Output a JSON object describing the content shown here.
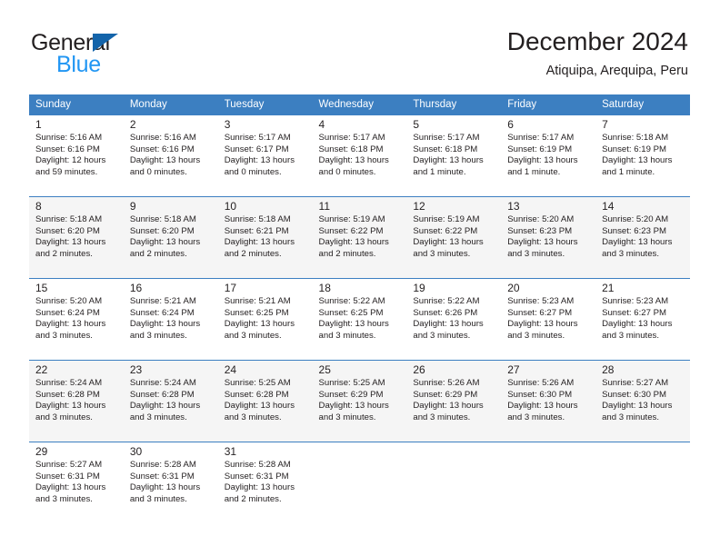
{
  "brand": {
    "word1": "General",
    "word2": "Blue",
    "flag_icon": "triangle-flag-icon",
    "accent_dark": "#1464aa",
    "accent_light": "#2196f3"
  },
  "header": {
    "title": "December 2024",
    "subtitle": "Atiquipa, Arequipa, Peru"
  },
  "calendar": {
    "header_bg": "#3c7fc1",
    "shaded_row_bg": "#f5f5f5",
    "weekday_headers": [
      "Sunday",
      "Monday",
      "Tuesday",
      "Wednesday",
      "Thursday",
      "Friday",
      "Saturday"
    ],
    "weeks": [
      {
        "shaded": false,
        "days": [
          {
            "num": "1",
            "detail": "Sunrise: 5:16 AM\nSunset: 6:16 PM\nDaylight: 12 hours\nand 59 minutes."
          },
          {
            "num": "2",
            "detail": "Sunrise: 5:16 AM\nSunset: 6:16 PM\nDaylight: 13 hours\nand 0 minutes."
          },
          {
            "num": "3",
            "detail": "Sunrise: 5:17 AM\nSunset: 6:17 PM\nDaylight: 13 hours\nand 0 minutes."
          },
          {
            "num": "4",
            "detail": "Sunrise: 5:17 AM\nSunset: 6:18 PM\nDaylight: 13 hours\nand 0 minutes."
          },
          {
            "num": "5",
            "detail": "Sunrise: 5:17 AM\nSunset: 6:18 PM\nDaylight: 13 hours\nand 1 minute."
          },
          {
            "num": "6",
            "detail": "Sunrise: 5:17 AM\nSunset: 6:19 PM\nDaylight: 13 hours\nand 1 minute."
          },
          {
            "num": "7",
            "detail": "Sunrise: 5:18 AM\nSunset: 6:19 PM\nDaylight: 13 hours\nand 1 minute."
          }
        ]
      },
      {
        "shaded": true,
        "days": [
          {
            "num": "8",
            "detail": "Sunrise: 5:18 AM\nSunset: 6:20 PM\nDaylight: 13 hours\nand 2 minutes."
          },
          {
            "num": "9",
            "detail": "Sunrise: 5:18 AM\nSunset: 6:20 PM\nDaylight: 13 hours\nand 2 minutes."
          },
          {
            "num": "10",
            "detail": "Sunrise: 5:18 AM\nSunset: 6:21 PM\nDaylight: 13 hours\nand 2 minutes."
          },
          {
            "num": "11",
            "detail": "Sunrise: 5:19 AM\nSunset: 6:22 PM\nDaylight: 13 hours\nand 2 minutes."
          },
          {
            "num": "12",
            "detail": "Sunrise: 5:19 AM\nSunset: 6:22 PM\nDaylight: 13 hours\nand 3 minutes."
          },
          {
            "num": "13",
            "detail": "Sunrise: 5:20 AM\nSunset: 6:23 PM\nDaylight: 13 hours\nand 3 minutes."
          },
          {
            "num": "14",
            "detail": "Sunrise: 5:20 AM\nSunset: 6:23 PM\nDaylight: 13 hours\nand 3 minutes."
          }
        ]
      },
      {
        "shaded": false,
        "days": [
          {
            "num": "15",
            "detail": "Sunrise: 5:20 AM\nSunset: 6:24 PM\nDaylight: 13 hours\nand 3 minutes."
          },
          {
            "num": "16",
            "detail": "Sunrise: 5:21 AM\nSunset: 6:24 PM\nDaylight: 13 hours\nand 3 minutes."
          },
          {
            "num": "17",
            "detail": "Sunrise: 5:21 AM\nSunset: 6:25 PM\nDaylight: 13 hours\nand 3 minutes."
          },
          {
            "num": "18",
            "detail": "Sunrise: 5:22 AM\nSunset: 6:25 PM\nDaylight: 13 hours\nand 3 minutes."
          },
          {
            "num": "19",
            "detail": "Sunrise: 5:22 AM\nSunset: 6:26 PM\nDaylight: 13 hours\nand 3 minutes."
          },
          {
            "num": "20",
            "detail": "Sunrise: 5:23 AM\nSunset: 6:27 PM\nDaylight: 13 hours\nand 3 minutes."
          },
          {
            "num": "21",
            "detail": "Sunrise: 5:23 AM\nSunset: 6:27 PM\nDaylight: 13 hours\nand 3 minutes."
          }
        ]
      },
      {
        "shaded": true,
        "days": [
          {
            "num": "22",
            "detail": "Sunrise: 5:24 AM\nSunset: 6:28 PM\nDaylight: 13 hours\nand 3 minutes."
          },
          {
            "num": "23",
            "detail": "Sunrise: 5:24 AM\nSunset: 6:28 PM\nDaylight: 13 hours\nand 3 minutes."
          },
          {
            "num": "24",
            "detail": "Sunrise: 5:25 AM\nSunset: 6:28 PM\nDaylight: 13 hours\nand 3 minutes."
          },
          {
            "num": "25",
            "detail": "Sunrise: 5:25 AM\nSunset: 6:29 PM\nDaylight: 13 hours\nand 3 minutes."
          },
          {
            "num": "26",
            "detail": "Sunrise: 5:26 AM\nSunset: 6:29 PM\nDaylight: 13 hours\nand 3 minutes."
          },
          {
            "num": "27",
            "detail": "Sunrise: 5:26 AM\nSunset: 6:30 PM\nDaylight: 13 hours\nand 3 minutes."
          },
          {
            "num": "28",
            "detail": "Sunrise: 5:27 AM\nSunset: 6:30 PM\nDaylight: 13 hours\nand 3 minutes."
          }
        ]
      },
      {
        "shaded": false,
        "days": [
          {
            "num": "29",
            "detail": "Sunrise: 5:27 AM\nSunset: 6:31 PM\nDaylight: 13 hours\nand 3 minutes."
          },
          {
            "num": "30",
            "detail": "Sunrise: 5:28 AM\nSunset: 6:31 PM\nDaylight: 13 hours\nand 3 minutes."
          },
          {
            "num": "31",
            "detail": "Sunrise: 5:28 AM\nSunset: 6:31 PM\nDaylight: 13 hours\nand 2 minutes."
          },
          {
            "num": "",
            "detail": ""
          },
          {
            "num": "",
            "detail": ""
          },
          {
            "num": "",
            "detail": ""
          },
          {
            "num": "",
            "detail": ""
          }
        ]
      }
    ]
  }
}
